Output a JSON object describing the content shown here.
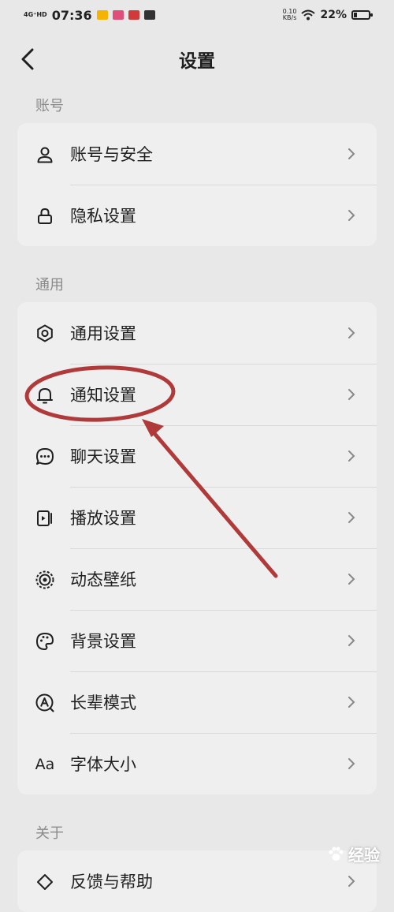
{
  "status_bar": {
    "network": "4G⁺HD",
    "time": "07:36",
    "speed_value": "0.10",
    "speed_unit": "KB/s",
    "battery": "22%",
    "battery_level": 0.22
  },
  "header": {
    "title": "设置"
  },
  "sections": {
    "account": {
      "label": "账号",
      "items": [
        {
          "label": "账号与安全",
          "icon": "person-icon"
        },
        {
          "label": "隐私设置",
          "icon": "lock-icon"
        }
      ]
    },
    "general": {
      "label": "通用",
      "items": [
        {
          "label": "通用设置",
          "icon": "gear-icon"
        },
        {
          "label": "通知设置",
          "icon": "bell-icon"
        },
        {
          "label": "聊天设置",
          "icon": "chat-bubble-icon"
        },
        {
          "label": "播放设置",
          "icon": "play-icon"
        },
        {
          "label": "动态壁纸",
          "icon": "live-wallpaper-icon"
        },
        {
          "label": "背景设置",
          "icon": "palette-icon"
        },
        {
          "label": "长辈模式",
          "icon": "elder-mode-icon"
        },
        {
          "label": "字体大小",
          "icon": "font-size-icon",
          "icon_text": "Aa"
        }
      ]
    },
    "about": {
      "label": "关于",
      "items": [
        {
          "label": "反馈与帮助",
          "icon": "feedback-icon"
        }
      ]
    }
  },
  "watermark": {
    "text": "经验"
  },
  "colors": {
    "background": "#e8e8e8",
    "card": "#efefef",
    "annotation": "#b03a3a",
    "section_label": "#8a8a8a"
  }
}
